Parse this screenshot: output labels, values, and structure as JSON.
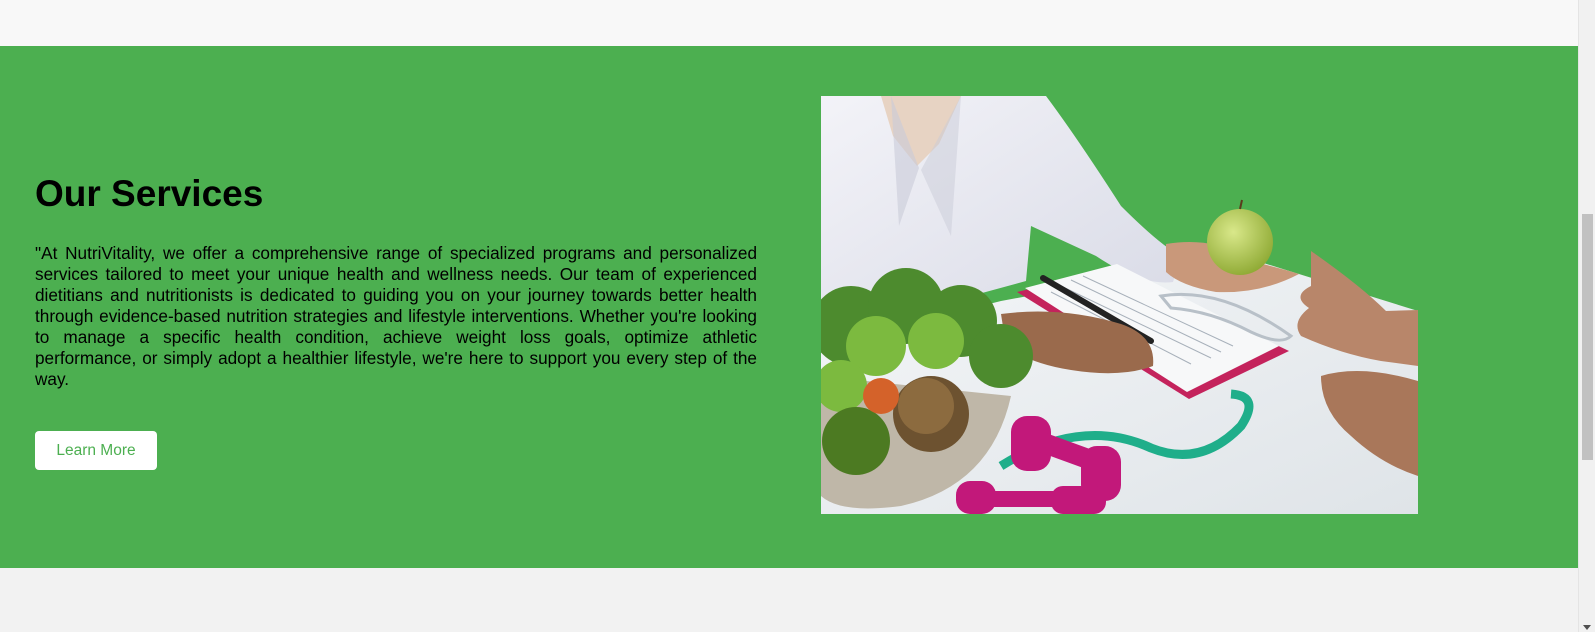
{
  "services": {
    "title": "Our Services",
    "description": "\"At NutriVitality, we offer a comprehensive range of specialized programs and personalized services tailored to meet your unique health and wellness needs. Our team of experienced dietitians and nutritionists is dedicated to guiding you on your journey towards better health through evidence-based nutrition strategies and lifestyle interventions. Whether you're looking to manage a specific health condition, achieve weight loss goals, optimize athletic performance, or simply adopt a healthier lifestyle, we're here to support you every step of the way.",
    "button_label": "Learn More"
  },
  "colors": {
    "section_background": "#4caf50",
    "button_text": "#4caf50",
    "page_background": "#f2f2f2"
  },
  "icons": {
    "scroll_down": "chevron-down-icon"
  }
}
